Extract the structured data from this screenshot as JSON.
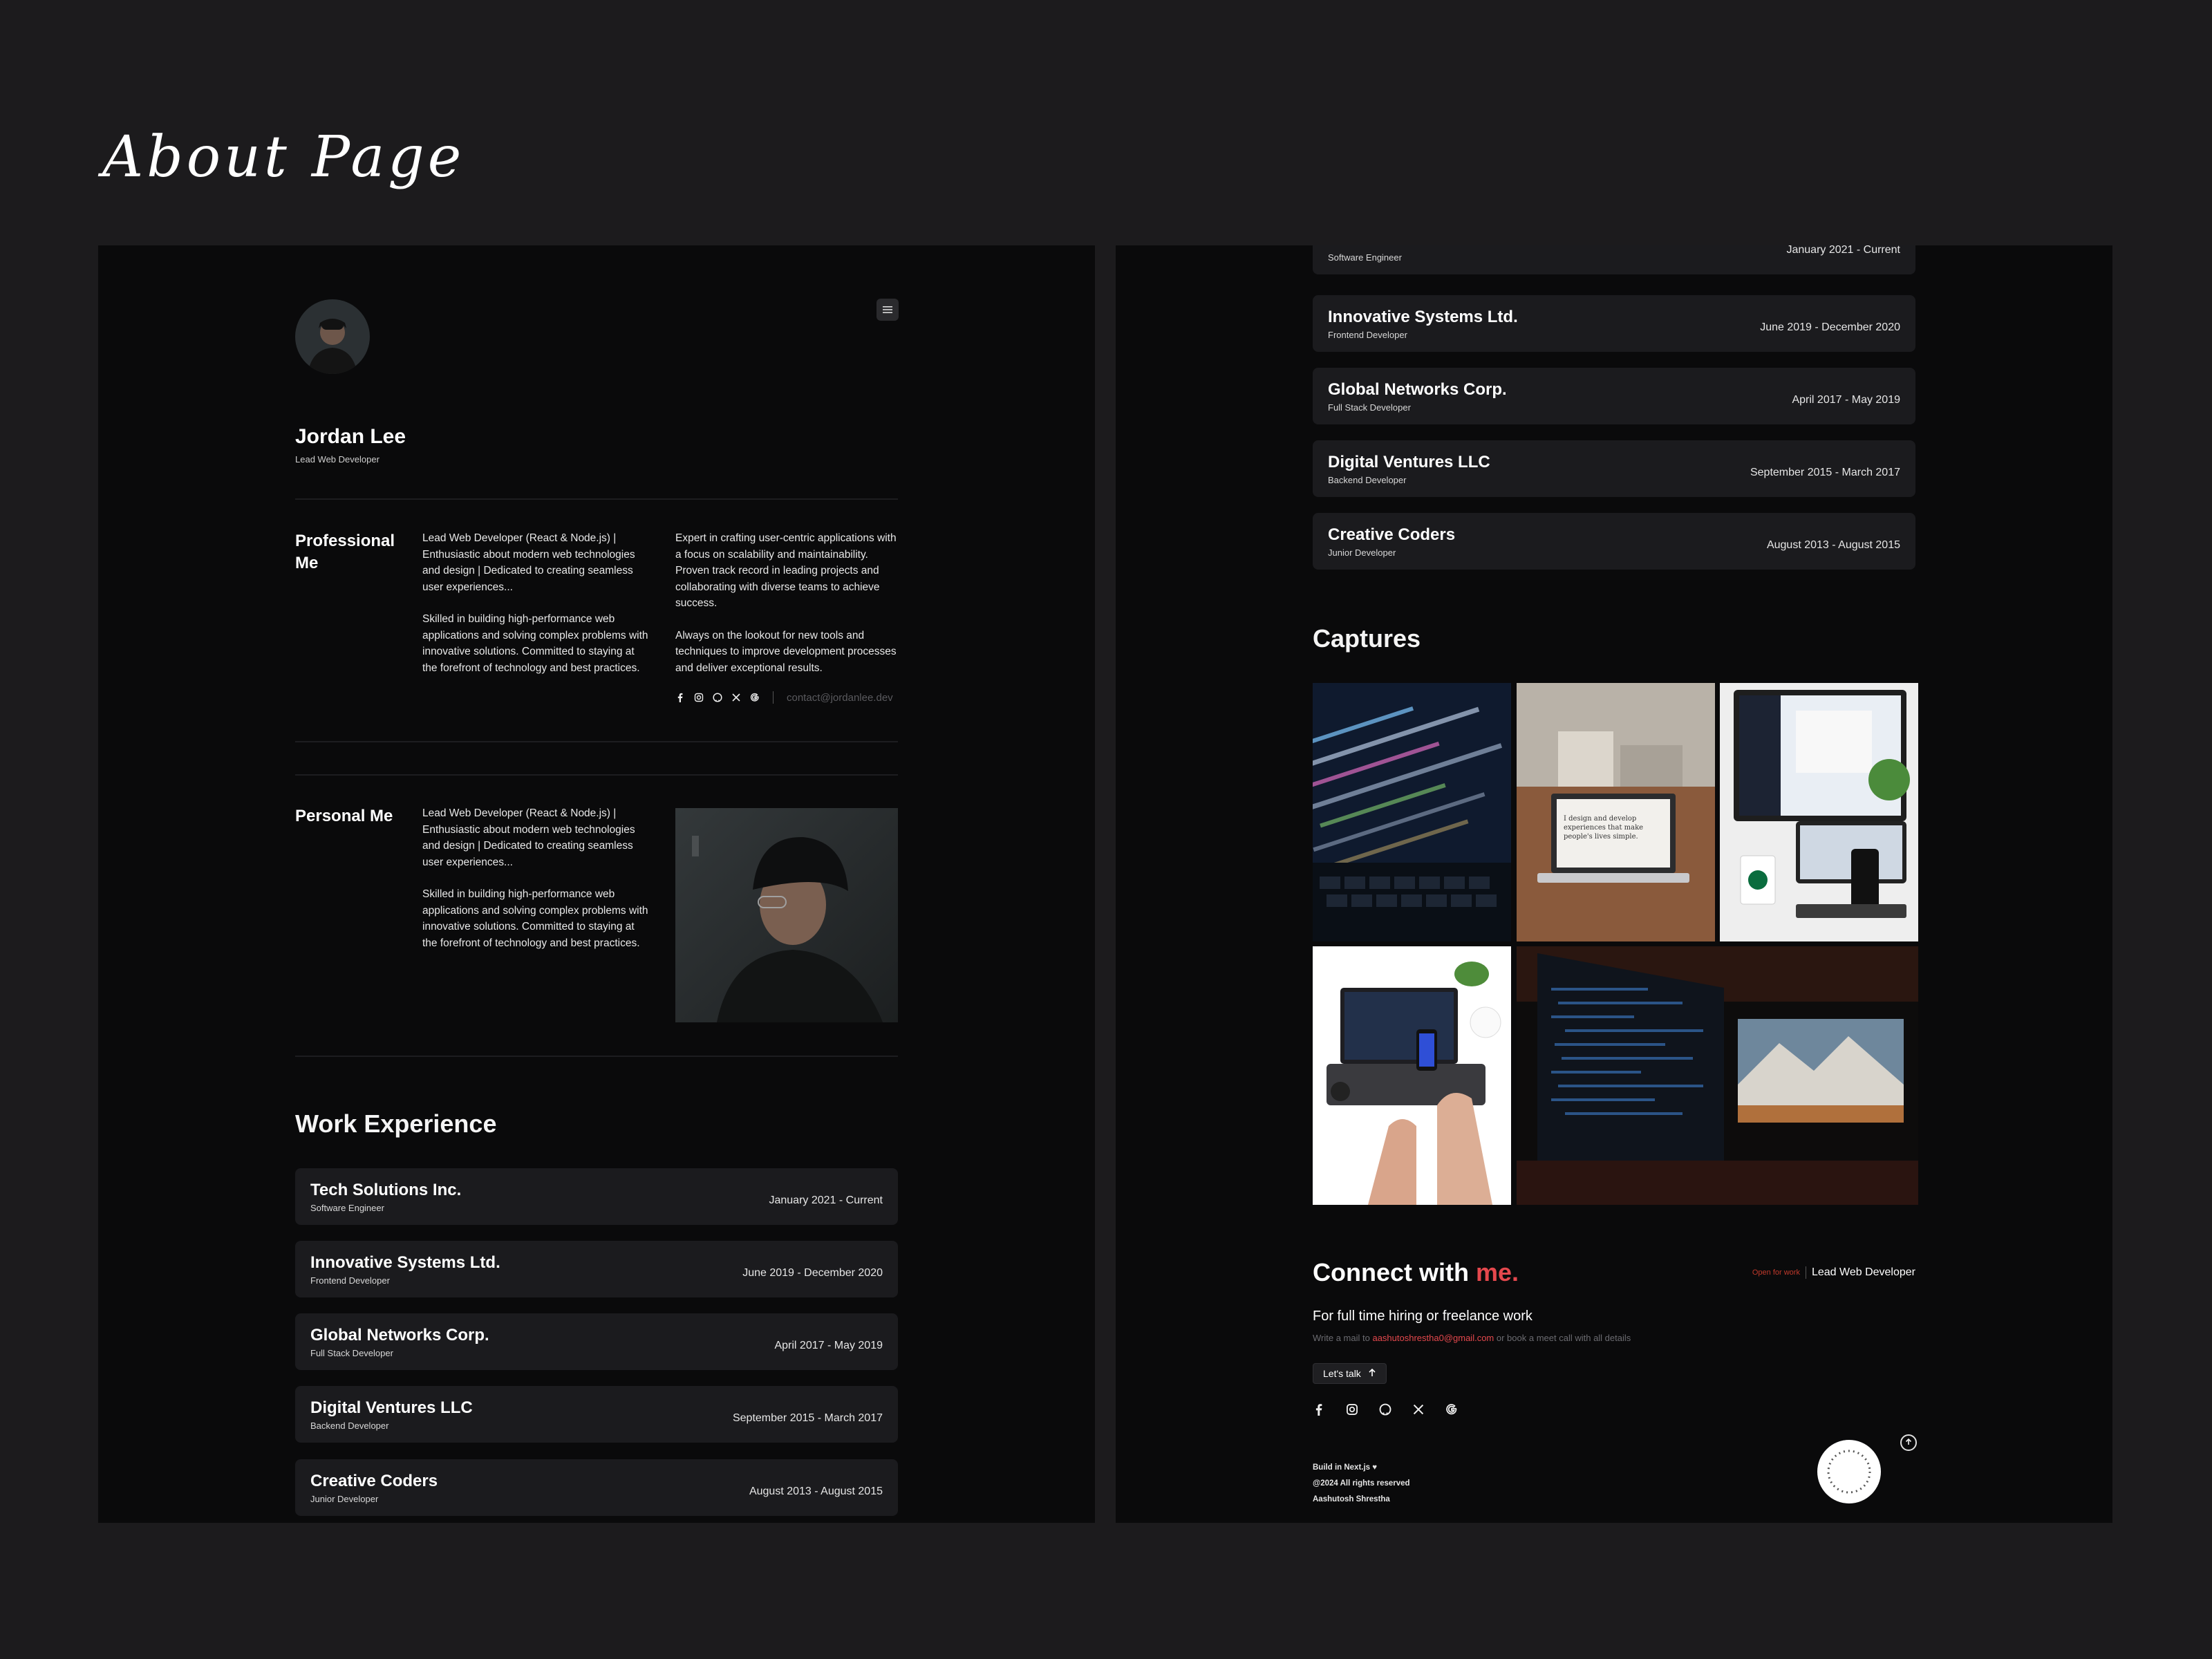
{
  "page_heading": "About Page",
  "profile": {
    "name": "Jordan Lee",
    "role": "Lead Web Developer"
  },
  "professional": {
    "label": "Professional Me",
    "col1": [
      "Lead Web Developer (React & Node.js) | Enthusiastic about modern web technologies and design | Dedicated to creating seamless user experiences...",
      "Skilled in building high-performance web applications and solving complex problems with innovative solutions. Committed to staying at the forefront of technology and best practices."
    ],
    "col2": [
      "Expert in crafting user-centric applications with a focus on scalability and maintainability. Proven track record in leading projects and collaborating with diverse teams to achieve success.",
      "Always on the lookout for new tools and techniques to improve development processes and deliver exceptional results."
    ],
    "email": "contact@jordanlee.dev"
  },
  "personal": {
    "label": "Personal Me",
    "paragraphs": [
      "Lead Web Developer (React & Node.js) | Enthusiastic about modern web technologies and design | Dedicated to creating seamless user experiences...",
      "Skilled in building high-performance web applications and solving complex problems with innovative solutions. Committed to staying at the forefront of technology and best practices."
    ]
  },
  "work": {
    "title": "Work Experience",
    "jobs": [
      {
        "company": "Tech Solutions Inc.",
        "title": "Software Engineer",
        "dates": "January 2021 - Current"
      },
      {
        "company": "Innovative Systems Ltd.",
        "title": "Frontend Developer",
        "dates": "June 2019 - December 2020"
      },
      {
        "company": "Global Networks Corp.",
        "title": "Full Stack Developer",
        "dates": "April 2017 - May 2019"
      },
      {
        "company": "Digital Ventures LLC",
        "title": "Backend Developer",
        "dates": "September 2015 - March 2017"
      },
      {
        "company": "Creative Coders",
        "title": "Junior Developer",
        "dates": "August 2013 - August 2015"
      }
    ]
  },
  "captures": {
    "title": "Captures",
    "laptop_screen_text": "I design and develop experiences that make people's lives simple."
  },
  "connect": {
    "title_main": "Connect with",
    "title_accent": "me.",
    "open_badge": "Open for work",
    "role": "Lead Web Developer",
    "hire_line": "For full time hiring or freelance work",
    "mail_prefix": "Write a mail to",
    "mail": "aashutoshrestha0@gmail.com",
    "mail_suffix": "or book a meet call with all details",
    "talk_button": "Let's talk",
    "built_with": "Build in Next.js",
    "rights": "@2024 All rights reserved",
    "author": "Aashutosh Shrestha"
  },
  "colors": {
    "accent": "#e5484d",
    "background": "#1c1b1d",
    "frame": "#0a0a0b",
    "card": "#1b1b1e"
  },
  "icons": [
    "facebook-icon",
    "instagram-icon",
    "github-icon",
    "x-icon",
    "google-icon",
    "menu-icon",
    "arrow-up-icon",
    "heart-icon"
  ]
}
